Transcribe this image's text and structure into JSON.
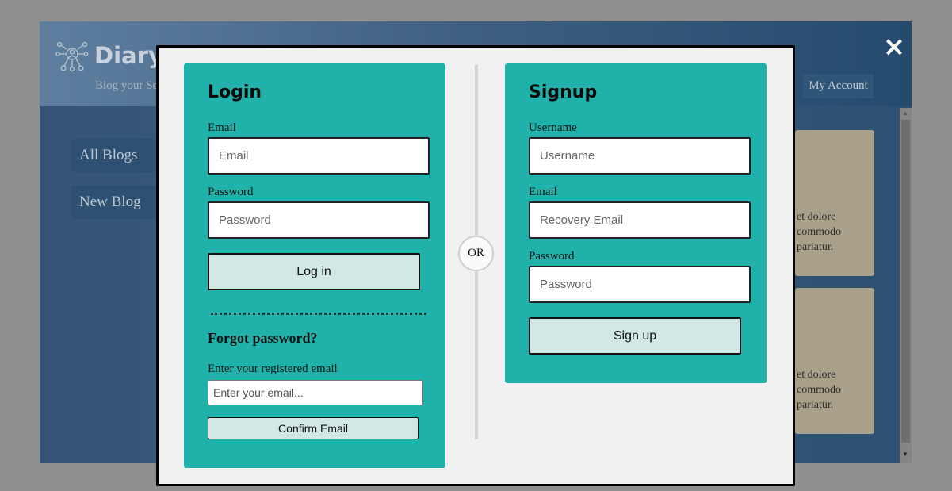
{
  "app": {
    "brand": "Diary",
    "tagline": "Blog your Se",
    "my_account": "My Account",
    "sidebar": [
      {
        "label": "All Blogs"
      },
      {
        "label": "New Blog"
      }
    ],
    "cards": [
      {
        "lines": [
          "et dolore",
          "commodo",
          "pariatur."
        ]
      },
      {
        "lines": [
          "et dolore",
          "commodo",
          "pariatur."
        ]
      }
    ]
  },
  "modal": {
    "close_icon": "×",
    "or_label": "OR",
    "login": {
      "title": "Login",
      "email_label": "Email",
      "email_placeholder": "Email",
      "password_label": "Password",
      "password_placeholder": "Password",
      "login_button": "Log in",
      "forgot_title": "Forgot password?",
      "forgot_label": "Enter your registered email",
      "forgot_placeholder": "Enter your email...",
      "confirm_button": "Confirm Email"
    },
    "signup": {
      "title": "Signup",
      "username_label": "Username",
      "username_placeholder": "Username",
      "email_label": "Email",
      "email_placeholder": "Recovery Email",
      "password_label": "Password",
      "password_placeholder": "Password",
      "signup_button": "Sign up"
    }
  },
  "colors": {
    "panel": "#20b2aa",
    "button": "#d1e8e6",
    "modal_bg": "#f1f1f1",
    "overlay": "#8f8f8f"
  }
}
